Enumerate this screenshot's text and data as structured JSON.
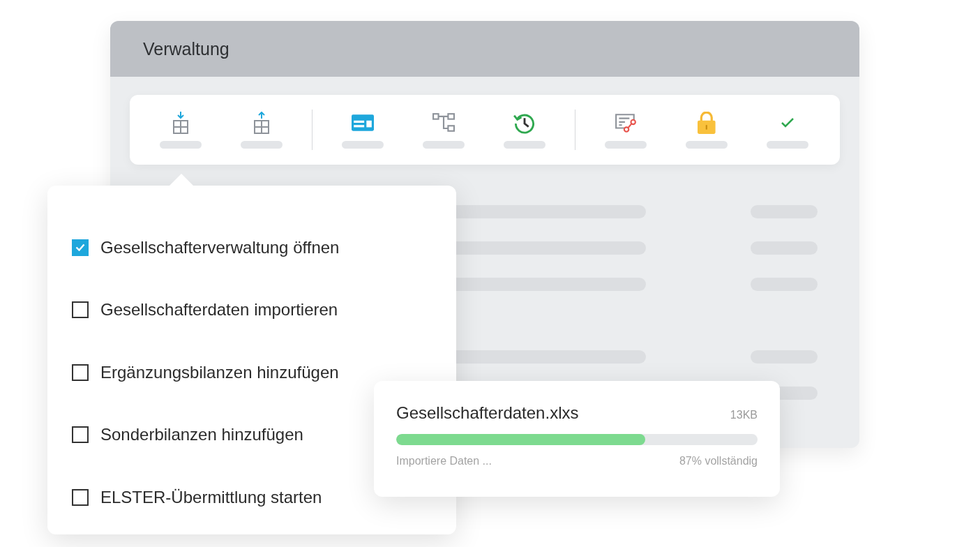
{
  "window": {
    "title": "Verwaltung"
  },
  "checklist": [
    {
      "label": "Gesellschafterverwaltung öffnen",
      "checked": true
    },
    {
      "label": "Gesellschafterdaten importieren",
      "checked": false
    },
    {
      "label": "Ergänzungsbilanzen hinzufügen",
      "checked": false
    },
    {
      "label": "Sonderbilanzen hinzufügen",
      "checked": false
    },
    {
      "label": "ELSTER-Übermittlung starten",
      "checked": false
    }
  ],
  "upload": {
    "filename": "Gesellschafterdaten.xlxs",
    "size": "13KB",
    "level": 0.69,
    "status": "Importiere Daten ...",
    "percent": "87% vollständig"
  }
}
